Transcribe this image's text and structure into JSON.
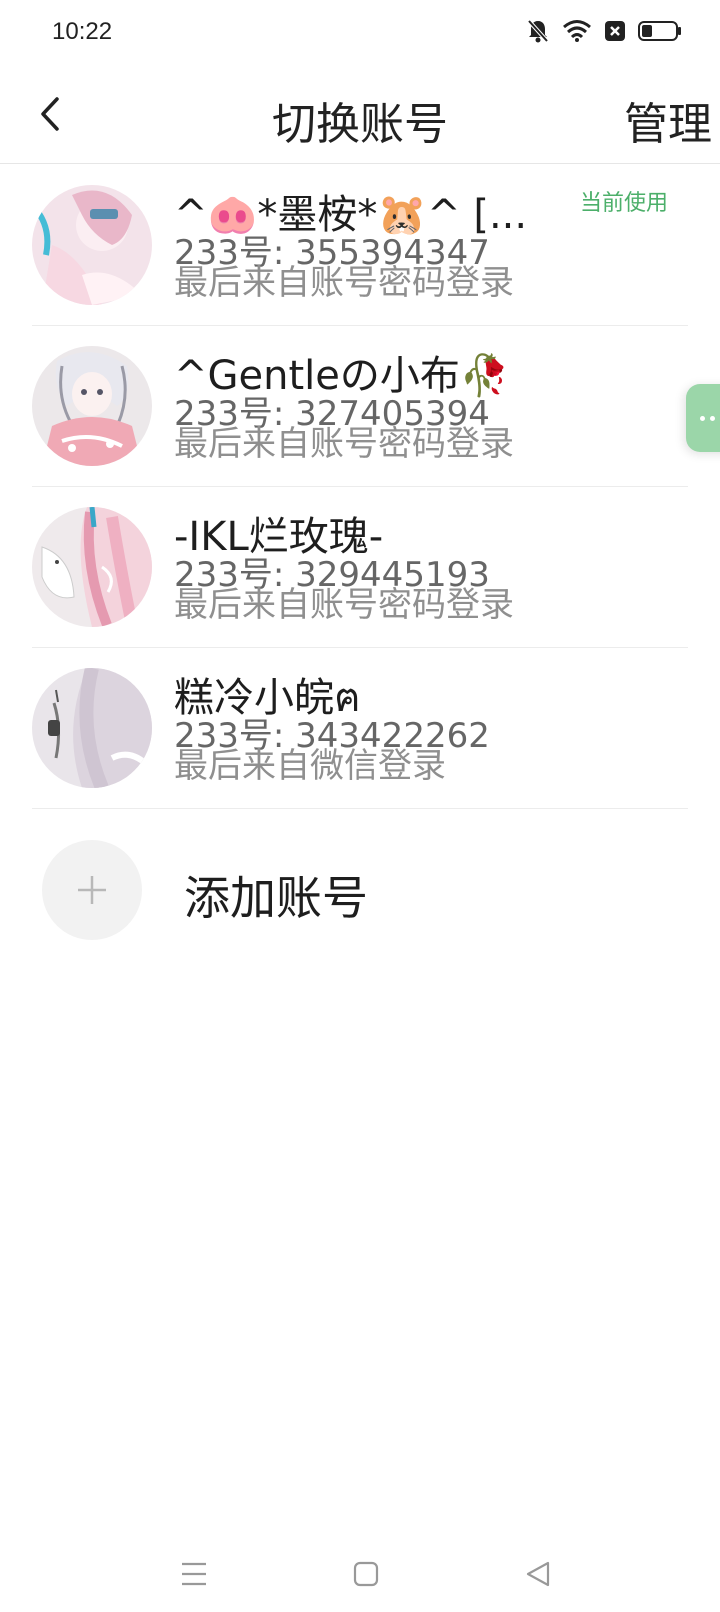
{
  "status_bar": {
    "time": "10:22",
    "icons": [
      "bell-off-icon",
      "wifi-icon",
      "notification-x-icon",
      "battery-icon"
    ],
    "battery_level": 0.3
  },
  "header": {
    "back_icon": "chevron-left-icon",
    "title": "切换账号",
    "manage_label": "管理"
  },
  "accounts": [
    {
      "name": "^🐽*墨桉*🐹^ [...",
      "uid": "233号: 355394347",
      "source": "最后来自账号密码登录",
      "current_tag": "当前使用"
    },
    {
      "name": "^Gentleの小布🥀",
      "uid": "233号: 327405394",
      "source": "最后来自账号密码登录"
    },
    {
      "name": "-IKL烂玫瑰-",
      "uid": "233号: 329445193",
      "source": "最后来自账号密码登录"
    },
    {
      "name": "糕冷小皖ฅ",
      "uid": "233号: 343422262",
      "source": "最后来自微信登录"
    }
  ],
  "add_account": {
    "label": "添加账号",
    "icon": "plus-icon"
  },
  "colors": {
    "accent_green": "#4caf6a",
    "bubble_green": "#9bd6a9",
    "divider": "#ececec"
  },
  "nav_bar": {
    "icons": [
      "menu-icon",
      "home-square-icon",
      "back-triangle-icon"
    ]
  }
}
